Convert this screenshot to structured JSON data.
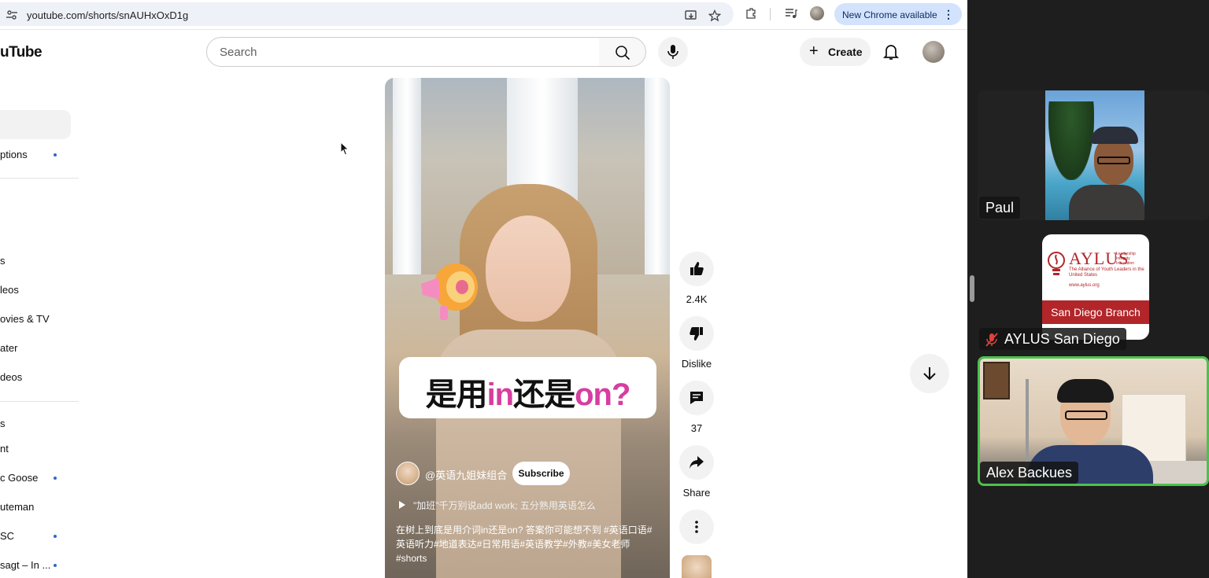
{
  "browser": {
    "url": "youtube.com/shorts/snAUHxOxD1g",
    "new_chrome_label": "New Chrome available"
  },
  "youtube": {
    "logo_text": "uTube",
    "search_placeholder": "Search",
    "create_label": "Create",
    "sidebar_items": [
      {
        "label": "ptions",
        "dot": true
      },
      {
        "label": "s",
        "dot": false
      },
      {
        "label": "leos",
        "dot": false
      },
      {
        "label": "ovies & TV",
        "dot": false
      },
      {
        "label": "ater",
        "dot": false
      },
      {
        "label": "deos",
        "dot": false
      },
      {
        "label": "s",
        "dot": false
      },
      {
        "label": "nt",
        "dot": false
      },
      {
        "label": "c Goose",
        "dot": true
      },
      {
        "label": "uteman",
        "dot": false
      },
      {
        "label": "SC",
        "dot": true
      },
      {
        "label": "sagt – In ...",
        "dot": true
      }
    ],
    "short": {
      "caption_part1": "是用",
      "caption_hl1": "in",
      "caption_part2": "还是",
      "caption_hl2": "on?",
      "channel_name": "@英语九姐妹组合",
      "subscribe_label": "Subscribe",
      "playlist_line": "\"加班\"千万别说add work; 五分熟用英语怎么",
      "description": "在树上到底是用介词in还是on? 答案你可能想不到 #英语口语#英语听力#地道表达#日常用语#英语教学#外教#美女老师#shorts"
    },
    "actions": {
      "like_count": "2.4K",
      "dislike_label": "Dislike",
      "comment_count": "37",
      "share_label": "Share"
    }
  },
  "meeting": {
    "participants": [
      {
        "name": "Paul"
      },
      {
        "name": "AYLUS San Diego",
        "muted": true
      },
      {
        "name": "Alex Backues",
        "active_speaker": true
      }
    ],
    "aylus_card": {
      "title": "AYLUS",
      "tagline": "Leadership Integrity Innovation",
      "subtitle": "The Alliance of Youth Leaders in the United States",
      "website": "www.aylus.org",
      "branch": "San Diego Branch"
    }
  },
  "colors": {
    "caption_highlight": "#d63ea0",
    "aylus_red": "#b2262a",
    "active_speaker_border": "#4cc24c",
    "chrome_update_pill": "#d3e3fd"
  }
}
